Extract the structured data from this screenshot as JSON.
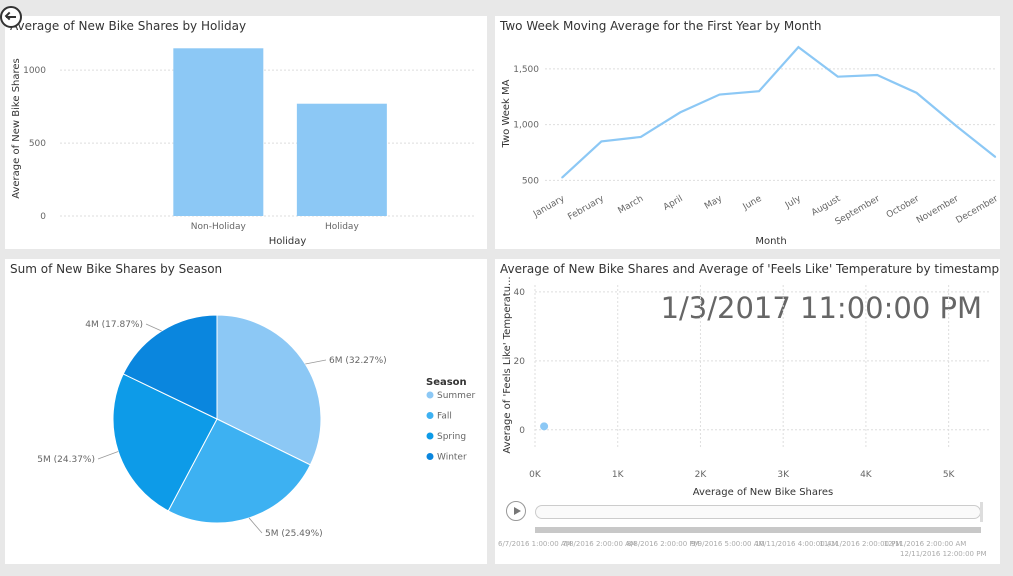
{
  "chart_data": [
    {
      "type": "bar",
      "title": "Average of New Bike Shares by Holiday",
      "xlabel": "Holiday",
      "ylabel": "Average of New Bike Shares",
      "categories": [
        "Non-Holiday",
        "Holiday"
      ],
      "values": [
        1150,
        770
      ],
      "ylim": [
        0,
        1200
      ],
      "yticks": [
        0,
        500,
        1000
      ],
      "ytick_labels": [
        "0",
        "500",
        "1000"
      ],
      "grid": true,
      "color": "#8cc8f5"
    },
    {
      "type": "line",
      "title": "Two Week Moving Average for the First Year by Month",
      "xlabel": "Month",
      "ylabel": "Two Week MA",
      "categories": [
        "January",
        "February",
        "March",
        "April",
        "May",
        "June",
        "July",
        "August",
        "September",
        "October",
        "November",
        "December"
      ],
      "values": [
        525,
        850,
        890,
        1110,
        1270,
        1300,
        1695,
        1430,
        1445,
        1285,
        990,
        710
      ],
      "ylim": [
        450,
        1750
      ],
      "yticks": [
        500,
        1000,
        1500
      ],
      "ytick_labels": [
        "500",
        "1,000",
        "1,500"
      ],
      "grid": true,
      "color": "#8cc8f5"
    },
    {
      "type": "pie",
      "title": "Sum of New Bike Shares by Season",
      "legend_title": "Season",
      "legend_position": "right",
      "slices": [
        {
          "name": "Summer",
          "value": 32.27,
          "label": "6M (32.27%)",
          "color": "#8cc8f5"
        },
        {
          "name": "Fall",
          "value": 25.49,
          "label": "5M (25.49%)",
          "color": "#3db1f2"
        },
        {
          "name": "Spring",
          "value": 24.37,
          "label": "5M (24.37%)",
          "color": "#0d9be8"
        },
        {
          "name": "Winter",
          "value": 17.87,
          "label": "4M (17.87%)",
          "color": "#0a86de"
        }
      ]
    },
    {
      "type": "scatter",
      "title": "Average of New Bike Shares and Average of 'Feels Like' Temperature by timestamp",
      "xlabel": "Average of New Bike Shares",
      "ylabel": "Average of 'Feels Like' Temperatu...",
      "xlim": [
        0,
        5500
      ],
      "ylim": [
        -5,
        42
      ],
      "xticks": [
        0,
        1000,
        2000,
        3000,
        4000,
        5000
      ],
      "xtick_labels": [
        "0K",
        "1K",
        "2K",
        "3K",
        "4K",
        "5K"
      ],
      "yticks": [
        0,
        20,
        40
      ],
      "ytick_labels": [
        "0",
        "20",
        "40"
      ],
      "points": [
        {
          "x": 110,
          "y": 1
        }
      ],
      "timestamp": "1/3/2017 11:00:00 PM",
      "color": "#8cc8f5",
      "play_axis_labels": [
        "6/7/2016 1:00:00 AM",
        "7/8/2016 2:00:00 AM",
        "8/8/2016 2:00:00 PM",
        "9/9/2016 5:00:00 AM",
        "10/11/2016 4:00:00 AM",
        "11/11/2016 2:00:00 PM",
        "12/11/2016 2:00:00 AM",
        "12/11/2016 12:00:00 PM"
      ]
    }
  ]
}
